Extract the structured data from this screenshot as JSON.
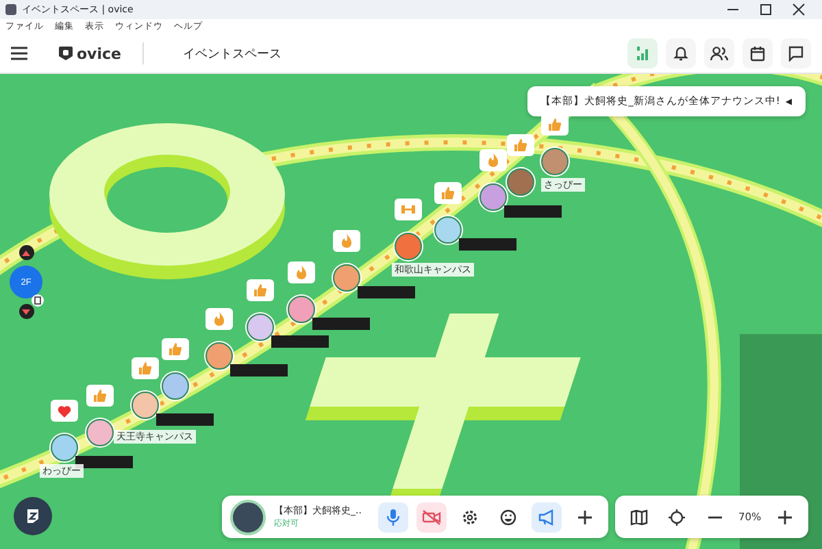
{
  "window": {
    "title": "イベントスペース | ovice"
  },
  "menu": [
    "ファイル",
    "編集",
    "表示",
    "ウィンドウ",
    "ヘルプ"
  ],
  "header": {
    "logo": "ovice",
    "space_name": "イベントスペース",
    "tools": [
      {
        "kind": "signal"
      },
      {
        "kind": "bell"
      },
      {
        "kind": "people"
      },
      {
        "kind": "calendar"
      },
      {
        "kind": "chat"
      }
    ]
  },
  "announcement": {
    "text": "【本部】犬飼将史_新潟さんが全体アナウンス中!",
    "icon": "◀"
  },
  "floor": {
    "label": "2F"
  },
  "avatars": [
    {
      "label": "わっぴー",
      "redacted": true,
      "reaction": {
        "kind": "heart"
      }
    },
    {
      "label": "天王寺キャンパス",
      "redacted": false,
      "reaction": {
        "kind": "thumbs"
      }
    },
    {
      "redacted": true,
      "reaction": {
        "kind": "thumbs"
      }
    },
    {
      "redacted": false,
      "reaction": {
        "kind": "thumbs"
      }
    },
    {
      "redacted": true,
      "reaction": {
        "kind": "fire"
      }
    },
    {
      "redacted": true,
      "reaction": {
        "kind": "thumbs"
      }
    },
    {
      "redacted": true,
      "reaction": {
        "kind": "fire"
      }
    },
    {
      "redacted": true,
      "reaction": {
        "kind": "fire"
      }
    },
    {
      "label": "和歌山キャンパス",
      "redacted": false,
      "reaction": {
        "kind": "dumbbell"
      }
    },
    {
      "redacted": true,
      "reaction": {
        "kind": "thumbs"
      }
    },
    {
      "redacted": true,
      "reaction": {
        "kind": "fire"
      }
    },
    {
      "redacted": false,
      "reaction": {
        "kind": "thumbs"
      }
    },
    {
      "label": "さっぴー",
      "redacted": false,
      "reaction": {
        "kind": "thumbs"
      }
    }
  ],
  "user_bar": {
    "name": "【本部】犬飼将史_..",
    "status": "応対可",
    "controls": [
      {
        "kind": "mic",
        "on": true
      },
      {
        "kind": "camera",
        "on": false
      },
      {
        "kind": "settings"
      },
      {
        "kind": "emoji"
      },
      {
        "kind": "announce",
        "on": true
      },
      {
        "kind": "add"
      }
    ]
  },
  "view_bar": {
    "zoom": "70%"
  }
}
